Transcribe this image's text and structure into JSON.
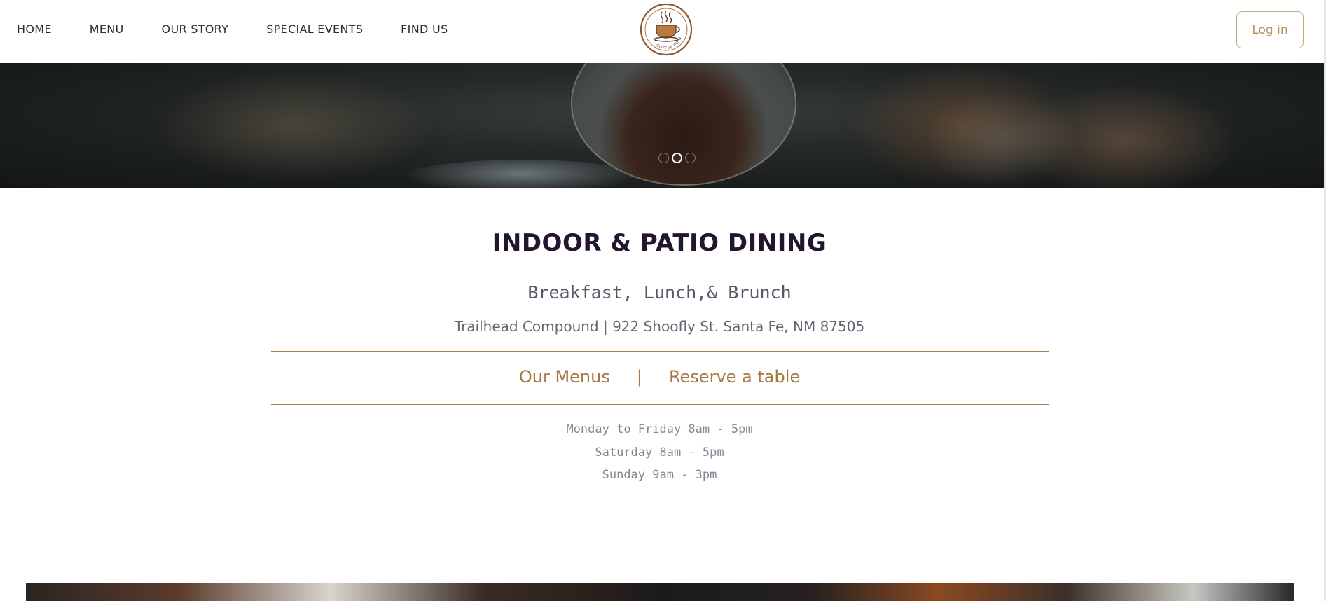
{
  "header": {
    "nav": [
      "HOME",
      "MENU",
      "OUR STORY",
      "SPECIAL EVENTS",
      "FIND US"
    ],
    "logo_text": "COFFEE POINT",
    "login_label": "Log in"
  },
  "hero": {
    "slides_count": 3,
    "active_slide": 2
  },
  "main": {
    "title": "INDOOR & PATIO DINING",
    "subtitle": "Breakfast, Lunch,& Brunch",
    "address": "Trailhead Compound | 922 Shoofly St. Santa Fe, NM 87505",
    "links": {
      "menus": "Our Menus",
      "separator": "|",
      "reserve": "Reserve a table"
    },
    "hours": [
      "Monday to Friday 8am - 5pm",
      "Saturday 8am - 5pm",
      "Sunday 9am - 3pm"
    ]
  },
  "colors": {
    "accent": "#a5793f",
    "title": "#24152f",
    "text": "#6b6272"
  }
}
